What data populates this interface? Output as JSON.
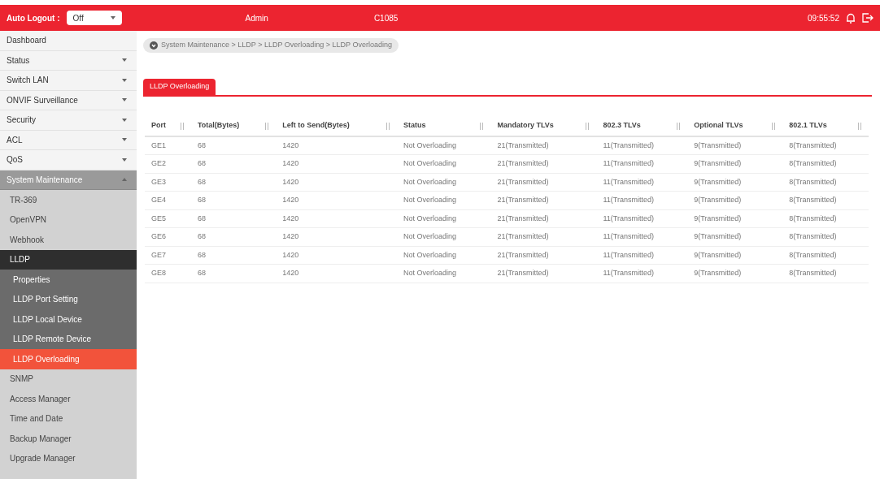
{
  "top_bar": {
    "auto_logout_label": "Auto Logout :",
    "auto_logout_value": "Off",
    "user": "Admin",
    "model": "C1085",
    "time": "09:55:52"
  },
  "sidebar": {
    "items": [
      {
        "label": "Dashboard",
        "expandable": false,
        "expanded": false,
        "selected": false
      },
      {
        "label": "Status",
        "expandable": true,
        "expanded": false,
        "selected": false
      },
      {
        "label": "Switch LAN",
        "expandable": true,
        "expanded": false,
        "selected": false
      },
      {
        "label": "ONVIF Surveillance",
        "expandable": true,
        "expanded": false,
        "selected": false
      },
      {
        "label": "Security",
        "expandable": true,
        "expanded": false,
        "selected": false
      },
      {
        "label": "ACL",
        "expandable": true,
        "expanded": false,
        "selected": false
      },
      {
        "label": "QoS",
        "expandable": true,
        "expanded": false,
        "selected": false
      },
      {
        "label": "System Maintenance",
        "expandable": true,
        "expanded": true,
        "selected": false,
        "children": [
          {
            "label": "TR-369",
            "expandable": false,
            "expanded": false,
            "selected": false
          },
          {
            "label": "OpenVPN",
            "expandable": false,
            "expanded": false,
            "selected": false
          },
          {
            "label": "Webhook",
            "expandable": false,
            "expanded": false,
            "selected": false
          },
          {
            "label": "LLDP",
            "expandable": false,
            "expanded": true,
            "selected": false,
            "children": [
              {
                "label": "Properties",
                "selected": false
              },
              {
                "label": "LLDP Port Setting",
                "selected": false
              },
              {
                "label": "LLDP Local Device",
                "selected": false
              },
              {
                "label": "LLDP Remote Device",
                "selected": false
              },
              {
                "label": "LLDP Overloading",
                "selected": true
              }
            ]
          },
          {
            "label": "SNMP",
            "expandable": false,
            "expanded": false,
            "selected": false
          },
          {
            "label": "Access Manager",
            "expandable": false,
            "expanded": false,
            "selected": false
          },
          {
            "label": "Time and Date",
            "expandable": false,
            "expanded": false,
            "selected": false
          },
          {
            "label": "Backup Manager",
            "expandable": false,
            "expanded": false,
            "selected": false
          },
          {
            "label": "Upgrade Manager",
            "expandable": false,
            "expanded": false,
            "selected": false
          }
        ]
      }
    ]
  },
  "breadcrumb": "System Maintenance > LLDP > LLDP Overloading > LLDP Overloading",
  "tabs": [
    {
      "label": "LLDP Overloading",
      "selected": true
    }
  ],
  "table": {
    "columns": [
      "Port",
      "Total(Bytes)",
      "Left to Send(Bytes)",
      "Status",
      "Mandatory TLVs",
      "802.3 TLVs",
      "Optional TLVs",
      "802.1 TLVs"
    ],
    "rows": [
      [
        "GE1",
        "68",
        "1420",
        "Not Overloading",
        "21(Transmitted)",
        "11(Transmitted)",
        "9(Transmitted)",
        "8(Transmitted)"
      ],
      [
        "GE2",
        "68",
        "1420",
        "Not Overloading",
        "21(Transmitted)",
        "11(Transmitted)",
        "9(Transmitted)",
        "8(Transmitted)"
      ],
      [
        "GE3",
        "68",
        "1420",
        "Not Overloading",
        "21(Transmitted)",
        "11(Transmitted)",
        "9(Transmitted)",
        "8(Transmitted)"
      ],
      [
        "GE4",
        "68",
        "1420",
        "Not Overloading",
        "21(Transmitted)",
        "11(Transmitted)",
        "9(Transmitted)",
        "8(Transmitted)"
      ],
      [
        "GE5",
        "68",
        "1420",
        "Not Overloading",
        "21(Transmitted)",
        "11(Transmitted)",
        "9(Transmitted)",
        "8(Transmitted)"
      ],
      [
        "GE6",
        "68",
        "1420",
        "Not Overloading",
        "21(Transmitted)",
        "11(Transmitted)",
        "9(Transmitted)",
        "8(Transmitted)"
      ],
      [
        "GE7",
        "68",
        "1420",
        "Not Overloading",
        "21(Transmitted)",
        "11(Transmitted)",
        "9(Transmitted)",
        "8(Transmitted)"
      ],
      [
        "GE8",
        "68",
        "1420",
        "Not Overloading",
        "21(Transmitted)",
        "11(Transmitted)",
        "9(Transmitted)",
        "8(Transmitted)"
      ]
    ]
  }
}
